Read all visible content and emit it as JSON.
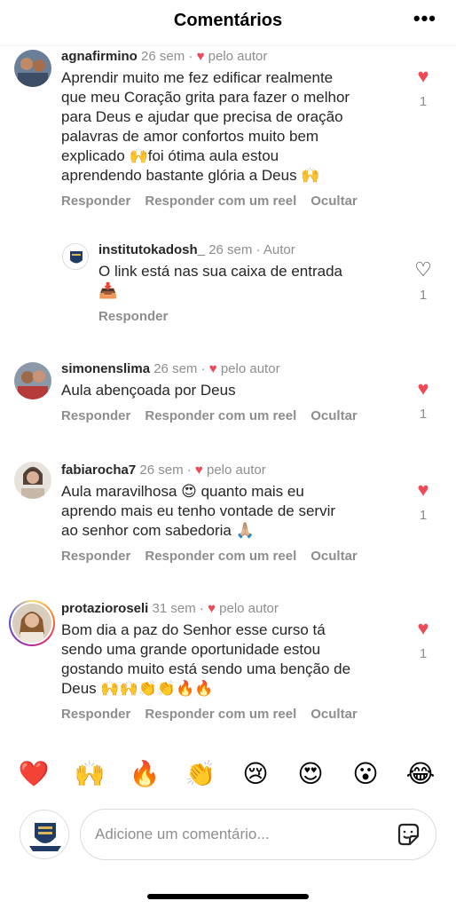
{
  "header": {
    "title": "Comentários",
    "more": "•••"
  },
  "comments": [
    {
      "user": "agnafirmino",
      "time": "26 sem",
      "sep": " · ",
      "liked_by_author": "pelo autor",
      "text": "Aprendir muito me fez edificar realmente\nque meu Coração grita para fazer o melhor\npara Deus e ajudar que precisa de oração\npalavras de amor confortos muito bem\nexplicado 🙌foi ótima aula estou\naprendendo bastante glória a Deus 🙌",
      "actions": [
        "Responder",
        "Responder com um reel",
        "Ocultar"
      ],
      "likes": "1"
    },
    {
      "user": "institutokadosh_",
      "time": "26 sem",
      "sep": " · ",
      "role": "Autor",
      "text": "O link está nas sua caixa de entrada\n📥",
      "actions": [
        "Responder"
      ],
      "likes": "1"
    },
    {
      "user": "simonenslima",
      "time": "26 sem",
      "sep": " · ",
      "liked_by_author": "pelo autor",
      "text": "Aula abençoada por Deus",
      "actions": [
        "Responder",
        "Responder com um reel",
        "Ocultar"
      ],
      "likes": "1"
    },
    {
      "user": "fabiarocha7",
      "time": "26 sem",
      "sep": " · ",
      "liked_by_author": "pelo autor",
      "text": "Aula maravilhosa 😍 quanto mais eu\naprendo mais eu tenho vontade de servir\nao senhor com sabedoria 🙏🏼",
      "actions": [
        "Responder",
        "Responder com um reel",
        "Ocultar"
      ],
      "likes": "1"
    },
    {
      "user": "protazioroseli",
      "time": "31 sem",
      "sep": " · ",
      "liked_by_author": "pelo autor",
      "text": "Bom dia a paz do Senhor esse curso tá\nsendo uma grande oportunidade estou\ngostando muito está sendo uma benção de\nDeus 🙌🙌👏👏🔥🔥",
      "actions": [
        "Responder",
        "Responder com um reel",
        "Ocultar"
      ],
      "likes": "1"
    }
  ],
  "reactions": [
    "❤️",
    "🙌",
    "🔥",
    "👏",
    "😢",
    "😍",
    "😮",
    "😂"
  ],
  "composer": {
    "placeholder": "Adicione um comentário..."
  },
  "colors": {
    "like_red": "#ed4956",
    "secondary_text": "#8e8e8e",
    "primary_text": "#262626"
  },
  "icons": {
    "liked": "heart-filled-icon",
    "unliked": "heart-outline-icon",
    "sticker": "sticker-icon",
    "more": "more-icon"
  }
}
